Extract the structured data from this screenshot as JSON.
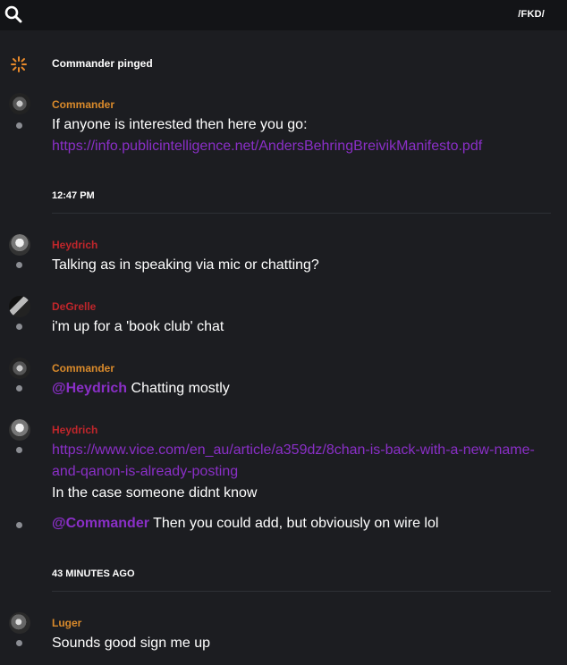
{
  "header": {
    "search_icon": "search-icon",
    "channel": "/FKD/"
  },
  "ping": {
    "icon": "ping-burst-icon",
    "text": "Commander pinged"
  },
  "colors": {
    "commander": "#d98a2b",
    "red_user": "#c0262b",
    "link": "#8a2fc7",
    "luger": "#d98a2b"
  },
  "messages": {
    "m1": {
      "author": "Commander",
      "text": "If anyone is interested then here you go:",
      "link": "https://info.publicintelligence.net/AndersBehringBreivikManifesto.pdf"
    },
    "sep1": "12:47 PM",
    "m2": {
      "author": "Heydrich",
      "text": "Talking as in speaking via mic or chatting?"
    },
    "m3": {
      "author": "DeGrelle",
      "text": "i'm up for a 'book club' chat"
    },
    "m4": {
      "author": "Commander",
      "mention": "@Heydrich",
      "text": " Chatting mostly"
    },
    "m5": {
      "author": "Heydrich",
      "link_line1": "https://www.vice.com/en_au/article/a359dz/8chan-is-back-with-a-new-name-",
      "link_line2": "and-qanon-is-already-posting",
      "text": "In the case someone didnt know"
    },
    "m6": {
      "mention": "@Commander",
      "text": " Then you could add, but obviously on wire lol"
    },
    "sep2": "43 MINUTES AGO",
    "m7": {
      "author": "Luger",
      "text": "Sounds good sign me up"
    }
  }
}
